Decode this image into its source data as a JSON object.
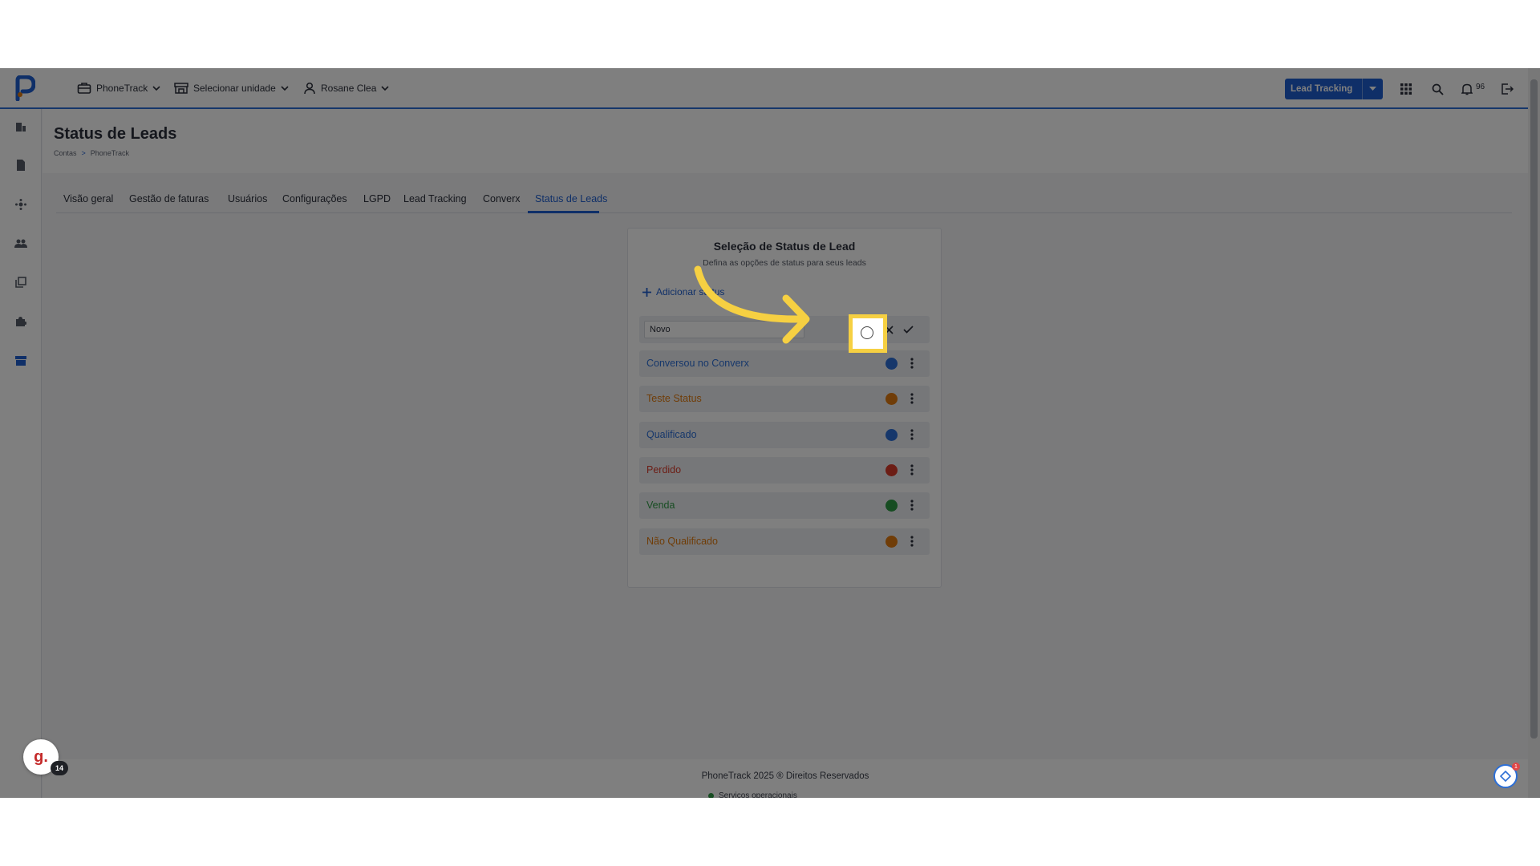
{
  "topbar": {
    "account": "PhoneTrack",
    "unit": "Selecionar unidade",
    "user": "Rosane Clea",
    "lead_tracking_button": "Lead Tracking",
    "notifications_count": "96"
  },
  "page": {
    "title": "Status de Leads",
    "breadcrumb": [
      "Contas",
      ">",
      "PhoneTrack"
    ]
  },
  "tabs": [
    {
      "label": "Visão geral"
    },
    {
      "label": "Gestão de faturas"
    },
    {
      "label": "Usuários"
    },
    {
      "label": "Configurações"
    },
    {
      "label": "LGPD"
    },
    {
      "label": "Lead Tracking"
    },
    {
      "label": "Converx"
    },
    {
      "label": "Status de Leads",
      "active": true
    }
  ],
  "card": {
    "title": "Seleção de Status de Lead",
    "subtitle": "Defina as opções de status para seus leads",
    "add_label": "Adicionar status",
    "edit_value": "Novo",
    "statuses": [
      {
        "label": "Conversou no Converx",
        "color": "#2d6fd6"
      },
      {
        "label": "Teste Status",
        "color": "#e07b10"
      },
      {
        "label": "Qualificado",
        "color": "#2d6fd6"
      },
      {
        "label": "Perdido",
        "color": "#d93b2b"
      },
      {
        "label": "Venda",
        "color": "#2f9a45"
      },
      {
        "label": "Não Qualificado",
        "color": "#e07b10"
      }
    ]
  },
  "footer": {
    "text": "PhoneTrack 2025 ® Direitos Reservados",
    "status": "Serviços operacionais"
  },
  "widgets": {
    "avatar_letter": "g.",
    "avatar_badge": "14",
    "help_badge": "1"
  },
  "colors": {
    "accent": "#1f5fd0",
    "highlight": "#f6d042"
  }
}
